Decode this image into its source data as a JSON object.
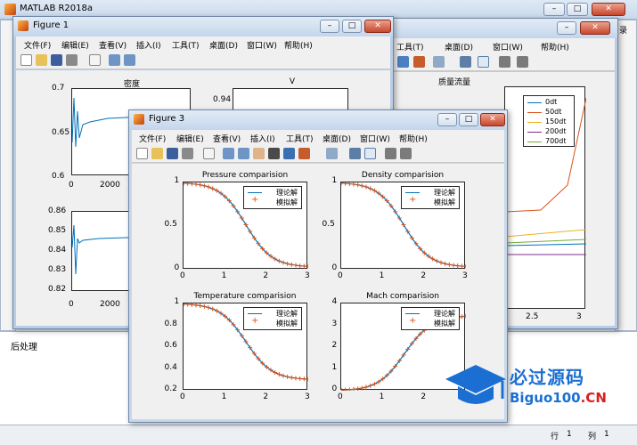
{
  "matlab": {
    "title": "MATLAB R2018a",
    "bottom_label": "后处理",
    "side_fragment": "录",
    "status": {
      "row_label": "行",
      "row": "1",
      "col_label": "列",
      "col": "1"
    }
  },
  "menu": [
    "文件(F)",
    "编辑(E)",
    "查看(V)",
    "插入(I)",
    "工具(T)",
    "桌面(D)",
    "窗口(W)",
    "帮助(H)"
  ],
  "figure1": {
    "title": "Figure 1",
    "axes": [
      {
        "title": "密度",
        "yticks": [
          "0.7",
          "0.65",
          "0.6"
        ],
        "xticks": [
          "0",
          "2000"
        ]
      },
      {
        "title": "V",
        "yticks": [
          "0.94"
        ]
      },
      {
        "title": "",
        "yticks": [
          "0.86",
          "0.85",
          "0.84",
          "0.83",
          "0.82"
        ],
        "xticks": [
          "0",
          "2000"
        ]
      }
    ]
  },
  "figure2": {
    "axes_title": "质量流量",
    "xticks": [
      "2.5",
      "3"
    ],
    "legend": [
      {
        "label": "0dt",
        "color": "#0072bd"
      },
      {
        "label": "50dt",
        "color": "#d95319"
      },
      {
        "label": "150dt",
        "color": "#edb120"
      },
      {
        "label": "200dt",
        "color": "#7e2f8e"
      },
      {
        "label": "700dt",
        "color": "#77ac30"
      }
    ]
  },
  "figure3": {
    "title": "Figure 3",
    "legend": {
      "theory": "理论解",
      "sim": "模拟解",
      "theory_color": "#0072bd",
      "sim_color": "#d95319"
    },
    "xticks": [
      "0",
      "1",
      "2",
      "3"
    ],
    "axes": [
      {
        "title": "Pressure comparision",
        "yticks": [
          "1",
          "0.5",
          "0"
        ]
      },
      {
        "title": "Density comparision",
        "yticks": [
          "1",
          "0.5",
          "0"
        ]
      },
      {
        "title": "Temperature comparision",
        "yticks": [
          "1",
          "0.8",
          "0.6",
          "0.4",
          "0.2"
        ]
      },
      {
        "title": "Mach comparision",
        "yticks": [
          "4",
          "3",
          "2",
          "1",
          "0"
        ]
      }
    ]
  },
  "watermark": {
    "line1": "必过源码",
    "line2_main": "Biguo100",
    "line2_suffix": ".CN"
  }
}
